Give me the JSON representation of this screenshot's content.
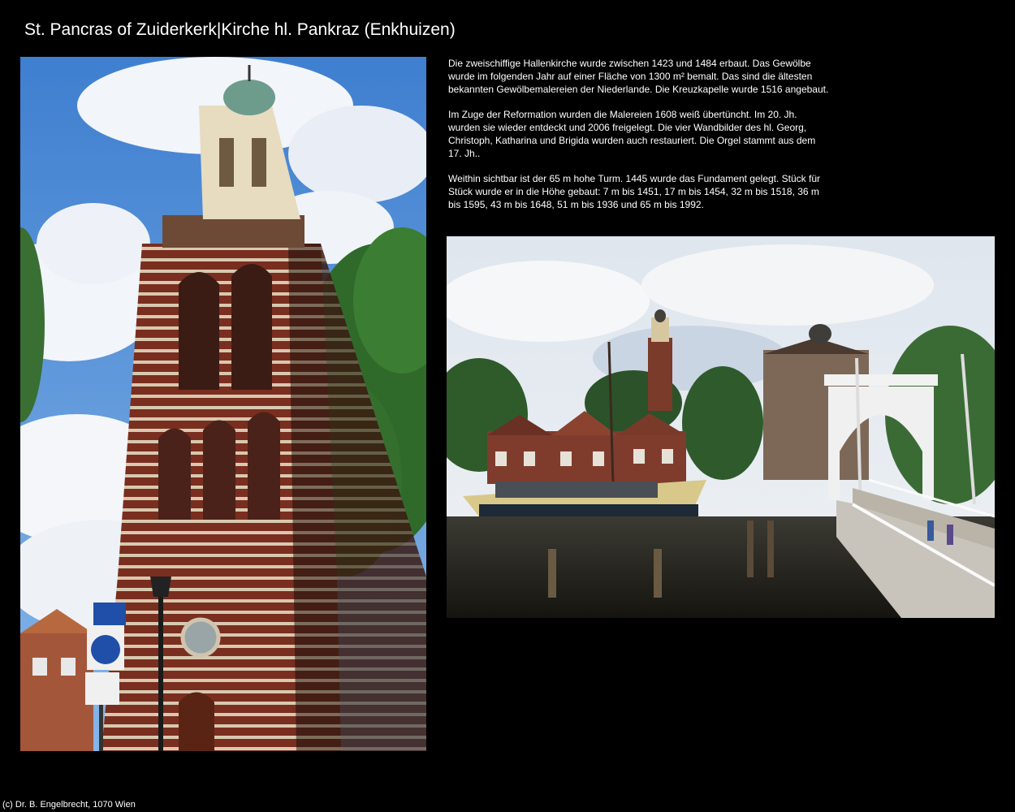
{
  "page": {
    "title": "St. Pancras of Zuiderkerk|Kirche hl. Pankraz (Enkhuizen)",
    "footer": "(c) Dr. B. Engelbrecht, 1070 Wien"
  },
  "description": {
    "paragraphs": [
      "Die zweischiffige Hallenkirche wurde zwischen 1423 und 1484 erbaut. Das Gewölbe wurde im folgenden Jahr auf einer Fläche von 1300 m² bemalt. Das sind die ältesten bekannten Gewölbemalereien der Niederlande. Die Kreuzkapelle wurde 1516 angebaut.",
      "Im Zuge der Reformation wurden die Malereien 1608 weiß übertüncht. Im 20. Jh. wurden sie wieder entdeckt und 2006 freigelegt. Die vier Wandbilder des hl. Georg, Christoph, Katharina und Brigida wurden auch restauriert. Die Orgel stammt aus dem 17. Jh..",
      "Weithin sichtbar ist der 65 m hohe Turm. 1445 wurde das Fundament gelegt. Stück für Stück wurde er in die Höhe gebaut: 7 m bis 1451, 17 m bis 1454, 32 m bis 1518, 36 m bis 1595, 43 m bis 1648, 51 m bis 1936 und 65 m bis 1992."
    ]
  },
  "photos": {
    "left": {
      "subject": "church-tower-photo"
    },
    "right": {
      "subject": "harbour-drawbridge-photo"
    }
  }
}
